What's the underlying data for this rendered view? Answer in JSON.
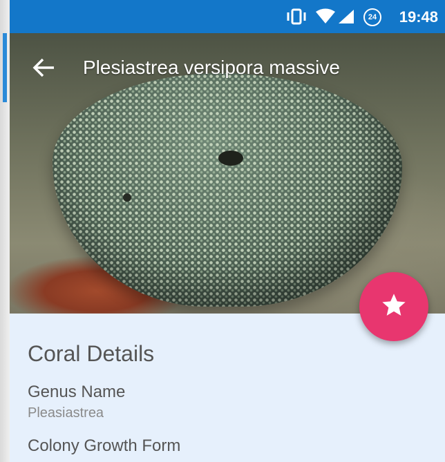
{
  "status_bar": {
    "time": "19:48",
    "icons": [
      "vibrate-icon",
      "wifi-icon",
      "signal-icon",
      "data-saver-icon"
    ],
    "badge_text": "24"
  },
  "toolbar": {
    "title": "Plesiastrea versipora massive",
    "back_icon": "arrow-left-icon"
  },
  "fab": {
    "icon": "star-icon",
    "color": "#e8366f"
  },
  "details": {
    "section_title": "Coral Details",
    "fields": [
      {
        "label": "Genus Name",
        "value": "Pleasiastrea"
      },
      {
        "label": "Colony Growth Form",
        "value": ""
      }
    ]
  },
  "colors": {
    "status_bar": "#1377c9",
    "background": "#e6f0fc",
    "accent": "#e8366f"
  }
}
